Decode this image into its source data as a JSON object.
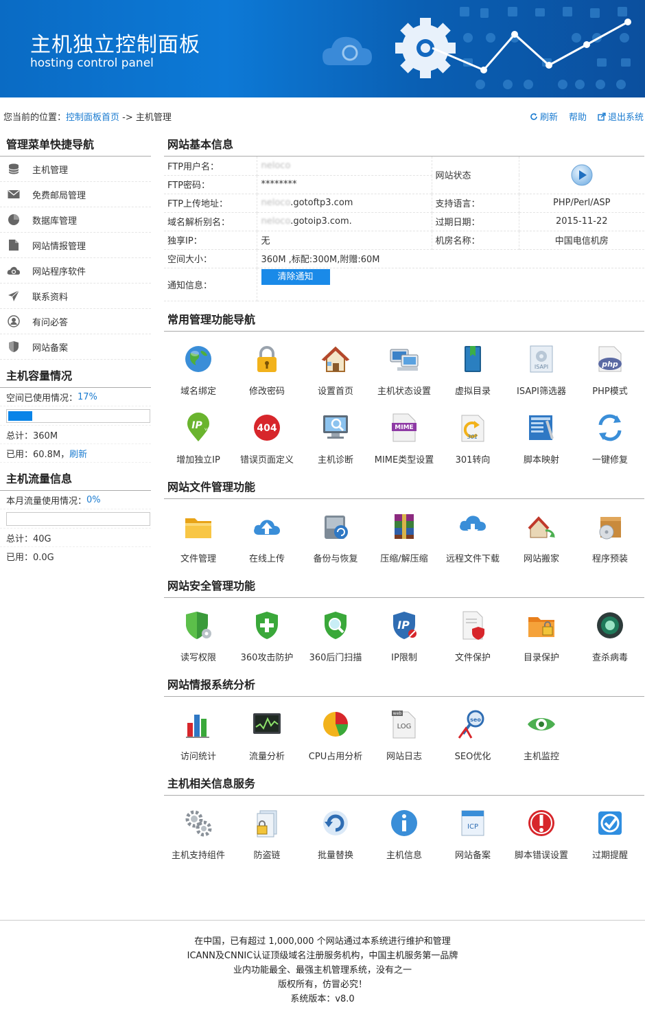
{
  "banner": {
    "title": "主机独立控制面板",
    "subtitle": "hosting control panel"
  },
  "breadcrumb": {
    "prefix": "您当前的位置：",
    "home_link": "控制面板首页",
    "arrow": "->",
    "current": "主机管理"
  },
  "top_links": {
    "refresh": "刷新",
    "help": "帮助",
    "logout": "退出系统"
  },
  "sidebar": {
    "menu_title": "管理菜单快捷导航",
    "menu": [
      {
        "label": "主机管理",
        "icon": "database-icon"
      },
      {
        "label": "免费邮局管理",
        "icon": "mail-icon"
      },
      {
        "label": "数据库管理",
        "icon": "pie-icon"
      },
      {
        "label": "网站情报管理",
        "icon": "document-icon"
      },
      {
        "label": "网站程序软件",
        "icon": "cloud-icon"
      },
      {
        "label": "联系资料",
        "icon": "send-icon"
      },
      {
        "label": "有问必答",
        "icon": "user-icon"
      },
      {
        "label": "网站备案",
        "icon": "shield-icon"
      }
    ],
    "capacity": {
      "title": "主机容量情况",
      "usage_label": "空间已使用情况：",
      "usage_pct": "17%",
      "usage_fraction": 0.17,
      "total": "总计：360M",
      "used": "已用：60.8M，",
      "refresh": "刷新"
    },
    "traffic": {
      "title": "主机流量信息",
      "usage_label": "本月流量使用情况：",
      "usage_pct": "0%",
      "usage_fraction": 0,
      "total": "总计：40G",
      "used": "已用：0.0G"
    }
  },
  "basic_info": {
    "title": "网站基本信息",
    "ftp_user_label": "FTP用户名：",
    "ftp_user": "neloco",
    "ftp_pass_label": "FTP密码：",
    "ftp_pass": "********",
    "ftp_addr_label": "FTP上传地址：",
    "ftp_addr_blur": "neloco",
    "ftp_addr": ".gotoftp3.com",
    "alias_label": "域名解析别名：",
    "alias_blur": "neloco",
    "alias": ".gotoip3.com.",
    "ip_label": "独享IP：",
    "ip": "无",
    "space_label": "空间大小：",
    "space": "360M ,标配:300M,附赠:60M",
    "notice_label": "通知信息：",
    "notice_button": "清除通知",
    "status_label": "网站状态",
    "lang_label": "支持语言：",
    "lang": "PHP/Perl/ASP",
    "expire_label": "过期日期：",
    "expire": "2015-11-22",
    "room_label": "机房名称：",
    "room": "中国电信机房"
  },
  "sections": [
    {
      "title": "常用管理功能导航",
      "items": [
        {
          "label": "域名绑定",
          "icon": "globe-icon"
        },
        {
          "label": "修改密码",
          "icon": "lock-icon"
        },
        {
          "label": "设置首页",
          "icon": "home-icon"
        },
        {
          "label": "主机状态设置",
          "icon": "computer-icon"
        },
        {
          "label": "虚拟目录",
          "icon": "book-icon"
        },
        {
          "label": "ISAPI筛选器",
          "icon": "isapi-icon"
        },
        {
          "label": "PHP模式",
          "icon": "php-icon"
        },
        {
          "label": "增加独立IP",
          "icon": "ip-pin-icon"
        },
        {
          "label": "错误页面定义",
          "icon": "error-404-icon"
        },
        {
          "label": "主机诊断",
          "icon": "diagnose-icon"
        },
        {
          "label": "MIME类型设置",
          "icon": "mime-icon"
        },
        {
          "label": "301转向",
          "icon": "redirect-icon"
        },
        {
          "label": "脚本映射",
          "icon": "script-map-icon"
        },
        {
          "label": "一键修复",
          "icon": "repair-icon"
        }
      ]
    },
    {
      "title": "网站文件管理功能",
      "items": [
        {
          "label": "文件管理",
          "icon": "folder-icon"
        },
        {
          "label": "在线上传",
          "icon": "upload-icon"
        },
        {
          "label": "备份与恢复",
          "icon": "backup-icon"
        },
        {
          "label": "压缩/解压缩",
          "icon": "archive-icon"
        },
        {
          "label": "远程文件下载",
          "icon": "download-icon"
        },
        {
          "label": "网站搬家",
          "icon": "move-icon"
        },
        {
          "label": "程序预装",
          "icon": "preinstall-icon"
        }
      ]
    },
    {
      "title": "网站安全管理功能",
      "items": [
        {
          "label": "读写权限",
          "icon": "permission-icon"
        },
        {
          "label": "360攻击防护",
          "icon": "shield-plus-icon"
        },
        {
          "label": "360后门扫描",
          "icon": "scan-icon"
        },
        {
          "label": "IP限制",
          "icon": "ip-limit-icon"
        },
        {
          "label": "文件保护",
          "icon": "file-protect-icon"
        },
        {
          "label": "目录保护",
          "icon": "folder-lock-icon"
        },
        {
          "label": "查杀病毒",
          "icon": "antivirus-icon"
        }
      ]
    },
    {
      "title": "网站情报系统分析",
      "items": [
        {
          "label": "访问统计",
          "icon": "bar-chart-icon"
        },
        {
          "label": "流量分析",
          "icon": "monitor-chart-icon"
        },
        {
          "label": "CPU占用分析",
          "icon": "pie-chart-icon"
        },
        {
          "label": "网站日志",
          "icon": "log-icon"
        },
        {
          "label": "SEO优化",
          "icon": "seo-icon"
        },
        {
          "label": "主机监控",
          "icon": "eye-icon"
        }
      ]
    },
    {
      "title": "主机相关信息服务",
      "items": [
        {
          "label": "主机支持组件",
          "icon": "gears-icon"
        },
        {
          "label": "防盗链",
          "icon": "anti-leech-icon"
        },
        {
          "label": "批量替换",
          "icon": "replace-icon"
        },
        {
          "label": "主机信息",
          "icon": "info-icon"
        },
        {
          "label": "网站备案",
          "icon": "icp-icon"
        },
        {
          "label": "脚本错误设置",
          "icon": "alert-icon"
        },
        {
          "label": "过期提醒",
          "icon": "check-icon"
        }
      ]
    }
  ],
  "footer": {
    "line1": "在中国，已有超过 1,000,000 个网站通过本系统进行维护和管理",
    "line2": "ICANN及CNNIC认证顶级域名注册服务机构，中国主机服务第一品牌",
    "line3": "业内功能最全、最强主机管理系统，没有之一",
    "line4": "版权所有，仿冒必究！",
    "line5": "系统版本：v8.0"
  }
}
